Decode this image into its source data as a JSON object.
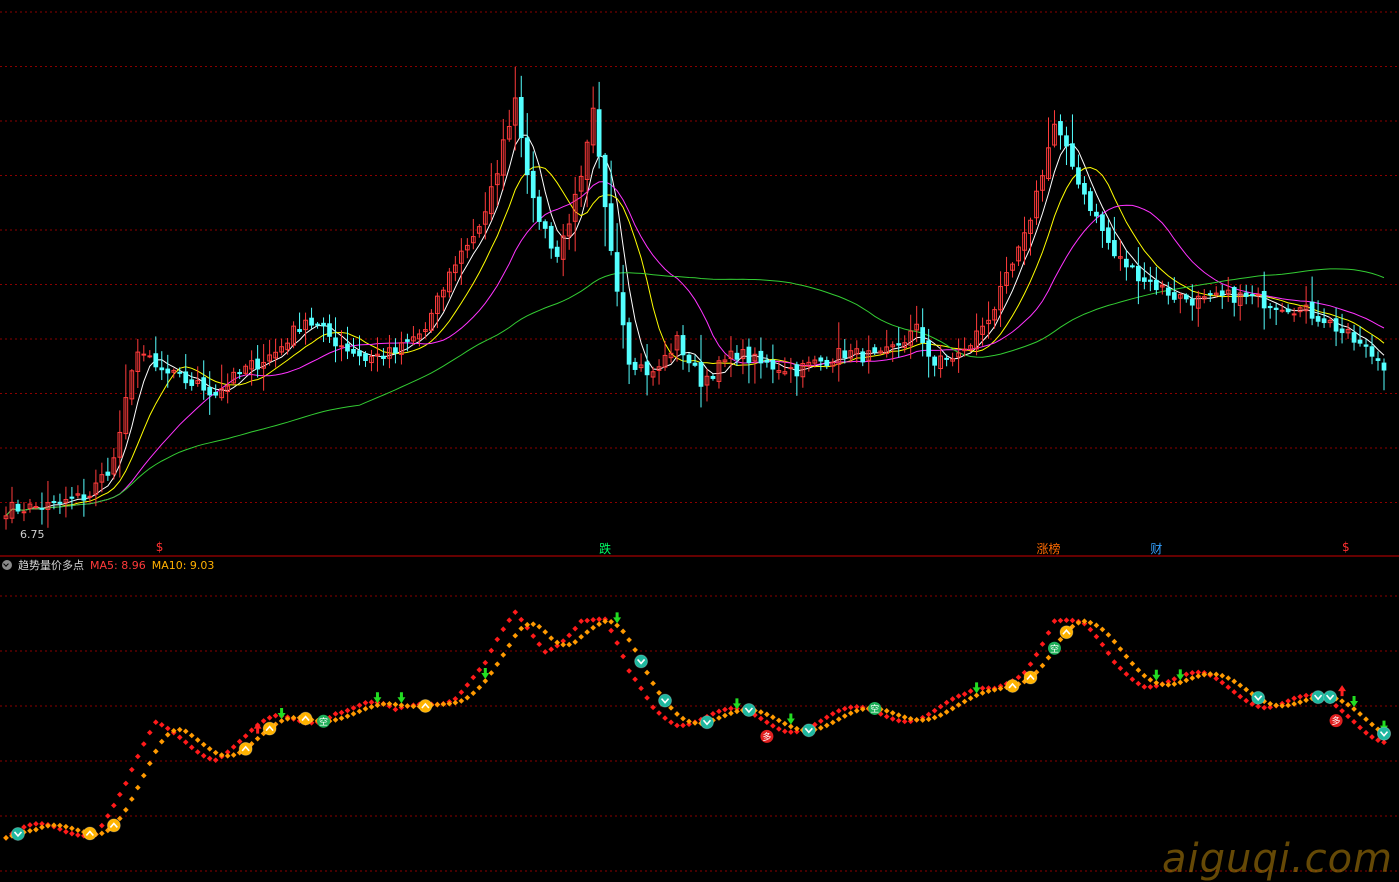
{
  "indicator": {
    "name": "趋势量价多点",
    "ma5_label": "MA5: 8.96",
    "ma10_label": "MA10: 9.03"
  },
  "price_low_label": "6.75",
  "event_markers": [
    {
      "text": "$",
      "bar": 26,
      "color": "#ff3030"
    },
    {
      "text": "跌",
      "bar": 100,
      "color": "#00ff66"
    },
    {
      "text": "涨榜",
      "bar": 173,
      "color": "#ff6a00"
    },
    {
      "text": "财",
      "bar": 192,
      "color": "#33a0ff"
    },
    {
      "text": "$",
      "bar": 224,
      "color": "#ff3030"
    }
  ],
  "watermark": "aiguqi.com",
  "colors": {
    "up": "#ff3b3b",
    "down": "#54ffff",
    "ma_white": "#ffffff",
    "ma_yellow": "#ffff00",
    "ma_magenta": "#ff33ff",
    "ma_green": "#33cc33",
    "grid": "#8b0000",
    "dot_red": "#ff1a1a",
    "dot_orange": "#ff9a00"
  },
  "chart_data": {
    "type": "candlestick",
    "price_anchors": [
      [
        0,
        7.05
      ],
      [
        8,
        7.1
      ],
      [
        14,
        7.3
      ],
      [
        18,
        7.9
      ],
      [
        22,
        9.9
      ],
      [
        25,
        9.5
      ],
      [
        30,
        9.3
      ],
      [
        35,
        9.1
      ],
      [
        40,
        9.5
      ],
      [
        45,
        9.8
      ],
      [
        50,
        10.4
      ],
      [
        55,
        10.0
      ],
      [
        60,
        9.7
      ],
      [
        65,
        9.8
      ],
      [
        70,
        10.2
      ],
      [
        75,
        11.4
      ],
      [
        80,
        12.2
      ],
      [
        85,
        14.3
      ],
      [
        88,
        12.4
      ],
      [
        92,
        11.5
      ],
      [
        96,
        12.8
      ],
      [
        98,
        14.0
      ],
      [
        100,
        12.3
      ],
      [
        104,
        9.7
      ],
      [
        108,
        9.4
      ],
      [
        112,
        10.0
      ],
      [
        116,
        9.3
      ],
      [
        122,
        9.8
      ],
      [
        126,
        9.6
      ],
      [
        132,
        9.5
      ],
      [
        140,
        9.8
      ],
      [
        146,
        9.7
      ],
      [
        152,
        10.2
      ],
      [
        155,
        9.6
      ],
      [
        160,
        9.8
      ],
      [
        165,
        10.6
      ],
      [
        170,
        11.8
      ],
      [
        175,
        13.8
      ],
      [
        180,
        12.6
      ],
      [
        185,
        11.5
      ],
      [
        190,
        11.1
      ],
      [
        195,
        10.8
      ],
      [
        200,
        10.7
      ],
      [
        205,
        10.8
      ],
      [
        210,
        10.7
      ],
      [
        215,
        10.6
      ],
      [
        220,
        10.4
      ],
      [
        225,
        10.0
      ],
      [
        230,
        9.6
      ]
    ],
    "ma_windows": [
      5,
      10,
      20,
      60
    ],
    "y_range": [
      6.5,
      16.0
    ],
    "last_bar_index": 230,
    "indicator_anchors": [
      [
        0,
        10
      ],
      [
        10,
        12
      ],
      [
        15,
        14
      ],
      [
        20,
        25
      ],
      [
        25,
        40
      ],
      [
        30,
        38
      ],
      [
        35,
        35
      ],
      [
        40,
        38
      ],
      [
        45,
        42
      ],
      [
        50,
        44
      ],
      [
        55,
        48
      ],
      [
        60,
        47
      ],
      [
        65,
        44
      ],
      [
        70,
        50
      ],
      [
        75,
        52
      ],
      [
        80,
        58
      ],
      [
        85,
        72
      ],
      [
        90,
        65
      ],
      [
        96,
        73
      ],
      [
        100,
        70
      ],
      [
        104,
        55
      ],
      [
        108,
        48
      ],
      [
        112,
        45
      ],
      [
        120,
        44
      ],
      [
        130,
        43
      ],
      [
        140,
        44
      ],
      [
        150,
        46
      ],
      [
        160,
        48
      ],
      [
        165,
        52
      ],
      [
        170,
        60
      ],
      [
        175,
        72
      ],
      [
        180,
        68
      ],
      [
        185,
        60
      ],
      [
        190,
        56
      ],
      [
        195,
        55
      ],
      [
        200,
        54
      ],
      [
        205,
        52
      ],
      [
        210,
        50
      ],
      [
        215,
        49
      ],
      [
        220,
        47
      ],
      [
        225,
        44
      ],
      [
        230,
        40
      ]
    ],
    "indicator_range": [
      0,
      80
    ],
    "signals": [
      {
        "bar": 2,
        "type": "down-badge"
      },
      {
        "bar": 14,
        "type": "up-badge"
      },
      {
        "bar": 18,
        "type": "up-badge"
      },
      {
        "bar": 40,
        "type": "up-badge"
      },
      {
        "bar": 42,
        "type": "arrow-up"
      },
      {
        "bar": 44,
        "type": "up-badge"
      },
      {
        "bar": 46,
        "type": "arrow-down"
      },
      {
        "bar": 50,
        "type": "up-badge"
      },
      {
        "bar": 53,
        "type": "kong"
      },
      {
        "bar": 62,
        "type": "arrow-down"
      },
      {
        "bar": 66,
        "type": "arrow-down"
      },
      {
        "bar": 70,
        "type": "up-badge"
      },
      {
        "bar": 80,
        "type": "arrow-down"
      },
      {
        "bar": 102,
        "type": "arrow-down"
      },
      {
        "bar": 106,
        "type": "down-badge"
      },
      {
        "bar": 110,
        "type": "down-badge"
      },
      {
        "bar": 117,
        "type": "down-badge"
      },
      {
        "bar": 122,
        "type": "arrow-down"
      },
      {
        "bar": 124,
        "type": "down-badge"
      },
      {
        "bar": 127,
        "type": "duo"
      },
      {
        "bar": 131,
        "type": "arrow-down"
      },
      {
        "bar": 134,
        "type": "down-badge"
      },
      {
        "bar": 145,
        "type": "kong"
      },
      {
        "bar": 162,
        "type": "arrow-down"
      },
      {
        "bar": 168,
        "type": "up-badge"
      },
      {
        "bar": 171,
        "type": "up-badge"
      },
      {
        "bar": 175,
        "type": "kong"
      },
      {
        "bar": 177,
        "type": "up-badge"
      },
      {
        "bar": 192,
        "type": "arrow-down"
      },
      {
        "bar": 196,
        "type": "arrow-down"
      },
      {
        "bar": 209,
        "type": "down-badge"
      },
      {
        "bar": 219,
        "type": "down-badge"
      },
      {
        "bar": 221,
        "type": "down-badge"
      },
      {
        "bar": 222,
        "type": "duo"
      },
      {
        "bar": 223,
        "type": "arrow-up"
      },
      {
        "bar": 225,
        "type": "arrow-down"
      },
      {
        "bar": 232,
        "type": "down-badge"
      },
      {
        "bar": 234,
        "type": "arrow-down"
      },
      {
        "bar": 236,
        "type": "down-badge"
      }
    ],
    "signal_glyphs": {
      "kong": "空",
      "duo": "多"
    }
  }
}
